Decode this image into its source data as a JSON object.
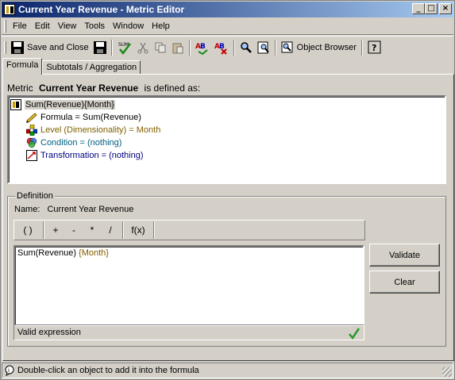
{
  "window": {
    "title": "Current Year Revenue - Metric Editor",
    "min_label": "_",
    "max_label": "□",
    "close_label": "×"
  },
  "menu": [
    {
      "label": "File",
      "key": "F"
    },
    {
      "label": "Edit",
      "key": "E"
    },
    {
      "label": "View",
      "key": "V"
    },
    {
      "label": "Tools",
      "key": "T"
    },
    {
      "label": "Window",
      "key": "W"
    },
    {
      "label": "Help",
      "key": "H"
    }
  ],
  "toolbar": {
    "save_close_label": "Save and Close",
    "object_browser_label": "Object Browser"
  },
  "tabs": [
    {
      "label": "Formula",
      "active": true
    },
    {
      "label": "Subtotals / Aggregation",
      "active": false
    }
  ],
  "metric_header": {
    "prefix": "Metric",
    "name": "Current Year Revenue",
    "suffix": "is defined as:"
  },
  "tree": {
    "root": "Sum(Revenue){Month}",
    "children": [
      {
        "label": "Formula = Sum(Revenue)",
        "color": "#000000",
        "icon": "formula-icon"
      },
      {
        "label": "Level (Dimensionality) = Month",
        "color": "#806000",
        "icon": "level-icon"
      },
      {
        "label": "Condition = (nothing)",
        "color": "#006080",
        "icon": "condition-icon"
      },
      {
        "label": "Transformation = (nothing)",
        "color": "#000080",
        "icon": "transformation-icon"
      }
    ]
  },
  "definition": {
    "legend": "Definition",
    "name_label": "Name:",
    "name_value": "Current Year Revenue",
    "operators": [
      "( )",
      "+",
      "-",
      "*",
      "/",
      "f(x)"
    ],
    "formula_part": "Sum(Revenue) ",
    "formula_level": "{Month}",
    "status": "Valid expression"
  },
  "buttons": {
    "validate": "Validate",
    "clear": "Clear"
  },
  "statusbar": {
    "text": "Double-click an object to add it into the formula"
  },
  "colors": {
    "title_start": "#0a246a",
    "title_end": "#a6caf0",
    "face": "#d4d0c8",
    "level_text": "#806000",
    "check": "#2a9a2a"
  }
}
